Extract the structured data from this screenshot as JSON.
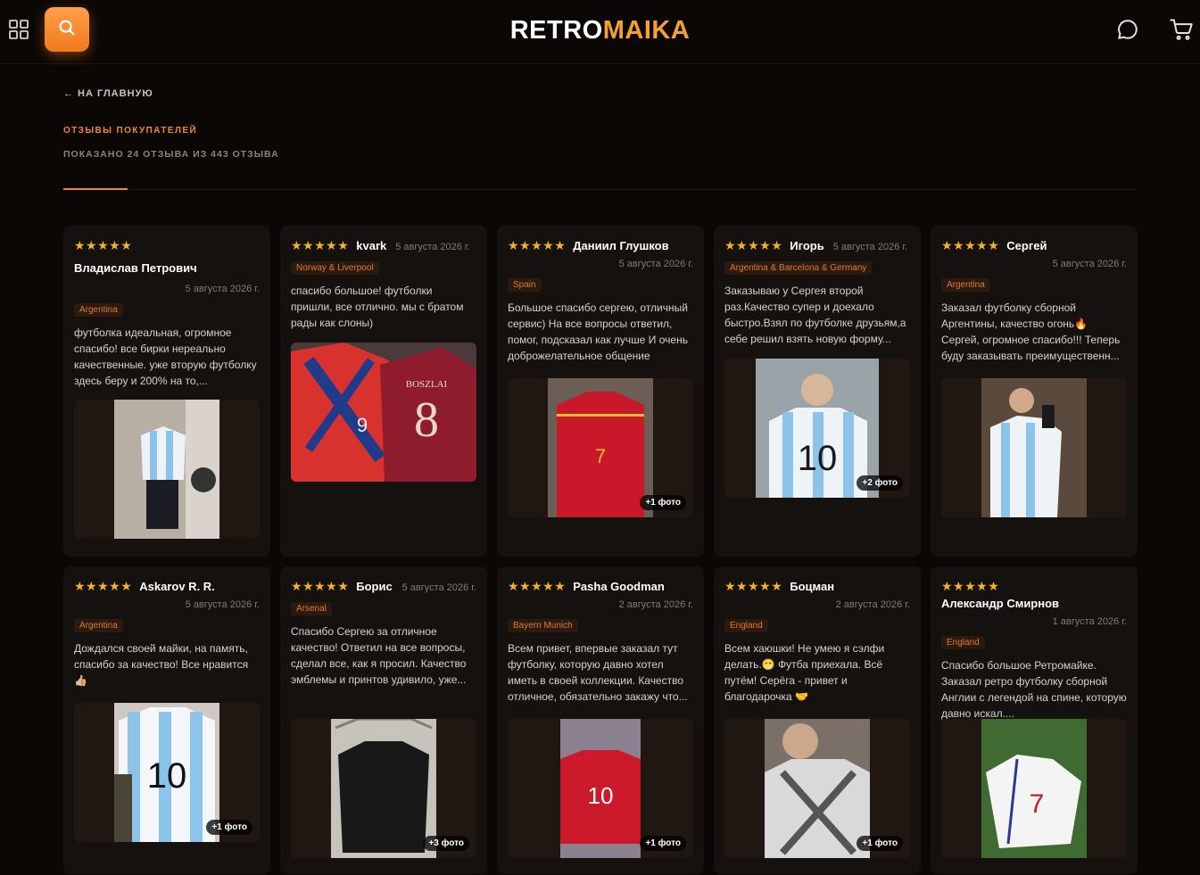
{
  "header": {
    "logo_part1": "RETRO",
    "logo_part2": "MAIKA",
    "icons": [
      "grid-icon",
      "search-icon",
      "chat-icon",
      "cart-icon"
    ],
    "accent": "#f08a2a"
  },
  "nav": {
    "back_label": "← НА ГЛАВНУЮ"
  },
  "section": {
    "title": "ОТЗЫВЫ ПОКУПАТЕЛЕЙ",
    "count": "ПОКАЗАНО 24 ОТЗЫВА ИЗ 443 ОТЗЫВА"
  },
  "reviews": [
    {
      "stars": "★★★★★",
      "name": "Владислав Петрович",
      "date": "5 августа 2026 г.",
      "tag": "Argentina",
      "text": "футболка идеальная, огромное спасибо! все бирки нереально качественные. уже вторую футболку здесь беру и 200% на то,...",
      "more": ""
    },
    {
      "stars": "★★★★★",
      "name": "kvark",
      "date": "5 августа 2026 г.",
      "tag": "Norway & Liverpool",
      "text": "спасибо большое! футболки пришли, все отлично. мы с братом рады как слоны)",
      "more": ""
    },
    {
      "stars": "★★★★★",
      "name": "Даниил Глушков",
      "date": "5 августа 2026 г.",
      "tag": "Spain",
      "text": "Большое спасибо сергею, отличный сервис) На все вопросы ответил, помог, подсказал как лучше И очень доброжелательное общение",
      "more": "+1 фото"
    },
    {
      "stars": "★★★★★",
      "name": "Игорь",
      "date": "5 августа 2026 г.",
      "tag": "Argentina & Barcelona & Germany",
      "text": "Заказываю у Сергея второй раз.Качество супер и доехало быстро.Взял по футболке друзьям,а себе решил взять новую форму...",
      "more": "+2 фото"
    },
    {
      "stars": "★★★★★",
      "name": "Сергей",
      "date": "5 августа 2026 г.",
      "tag": "Argentina",
      "text": "Заказал футболку сборной Аргентины, качество огонь🔥 Сергей, огромное спасибо!!! Теперь буду заказывать преимущественн...",
      "more": ""
    },
    {
      "stars": "★★★★★",
      "name": "Askarov R. R.",
      "date": "5 августа 2026 г.",
      "tag": "Argentina",
      "text": "Дождался своей майки, на память, спасибо за качество! Все нравится 👍🏼",
      "more": "+1 фото"
    },
    {
      "stars": "★★★★★",
      "name": "Борис",
      "date": "5 августа 2026 г.",
      "tag": "Arsenal",
      "text": "Спасибо Сергею за отличное качество! Ответил на все вопросы, сделал все, как я просил. Качество эмблемы и принтов удивило, уже...",
      "more": "+3 фото"
    },
    {
      "stars": "★★★★★",
      "name": "Pasha Goodman",
      "date": "2 августа 2026 г.",
      "tag": "Bayern Munich",
      "text": "Всем привет, впервые заказал тут футболку, которую давно хотел иметь в своей коллекции. Качество отличное, обязательно закажу что...",
      "more": "+1 фото"
    },
    {
      "stars": "★★★★★",
      "name": "Боцман",
      "date": "2 августа 2026 г.",
      "tag": "England",
      "text": "Всем хаюшки! Не умею я сэлфи делать.😁 Футба приехала. Всё путём! Серёга - привет и благодарочка 🤝",
      "more": "+1 фото"
    },
    {
      "stars": "★★★★★",
      "name": "Александр Смирнов",
      "date": "1 августа 2026 г.",
      "tag": "England",
      "text": "Спасибо большое Ретромайке. Заказал ретро футболку сборной Англии с легендой на спине, которую давно искал....",
      "more": ""
    }
  ]
}
